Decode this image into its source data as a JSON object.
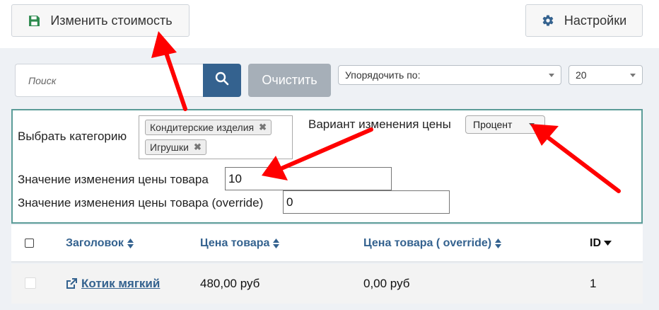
{
  "toolbar": {
    "save_label": "Изменить стоимость",
    "settings_label": "Настройки"
  },
  "search": {
    "placeholder": "Поиск",
    "clear_label": "Очистить"
  },
  "sort": {
    "selected": "Упорядочить по:"
  },
  "per_page": {
    "selected": "20"
  },
  "filter": {
    "category_label": "Выбрать категорию",
    "categories": [
      "Кондитерские изделия",
      "Игрушки"
    ],
    "variant_label": "Вариант изменения цены",
    "variant_value": "Процент",
    "value_label": "Значение изменения цены товара",
    "value": "10",
    "override_label": "Значение изменения цены товара (override)",
    "override_value": "0"
  },
  "table": {
    "columns": [
      "Заголовок",
      "Цена товара",
      "Цена товара ( override)",
      "ID"
    ],
    "rows": [
      {
        "title": "Котик мягкий",
        "price": "480,00 руб",
        "override_price": "0,00 руб",
        "id": "1"
      }
    ]
  },
  "icons": {
    "save": "floppy-disk-icon",
    "settings": "gear-icon",
    "search": "search-icon",
    "remove_tag": "close-icon",
    "sort": "sort-icon",
    "sort_desc": "caret-down-icon",
    "external_link": "external-link-icon"
  },
  "colors": {
    "accent": "#34628f",
    "panel_border": "#5b9c98",
    "annotation_arrow": "#ff0000",
    "clear_button": "#a6afb8"
  }
}
